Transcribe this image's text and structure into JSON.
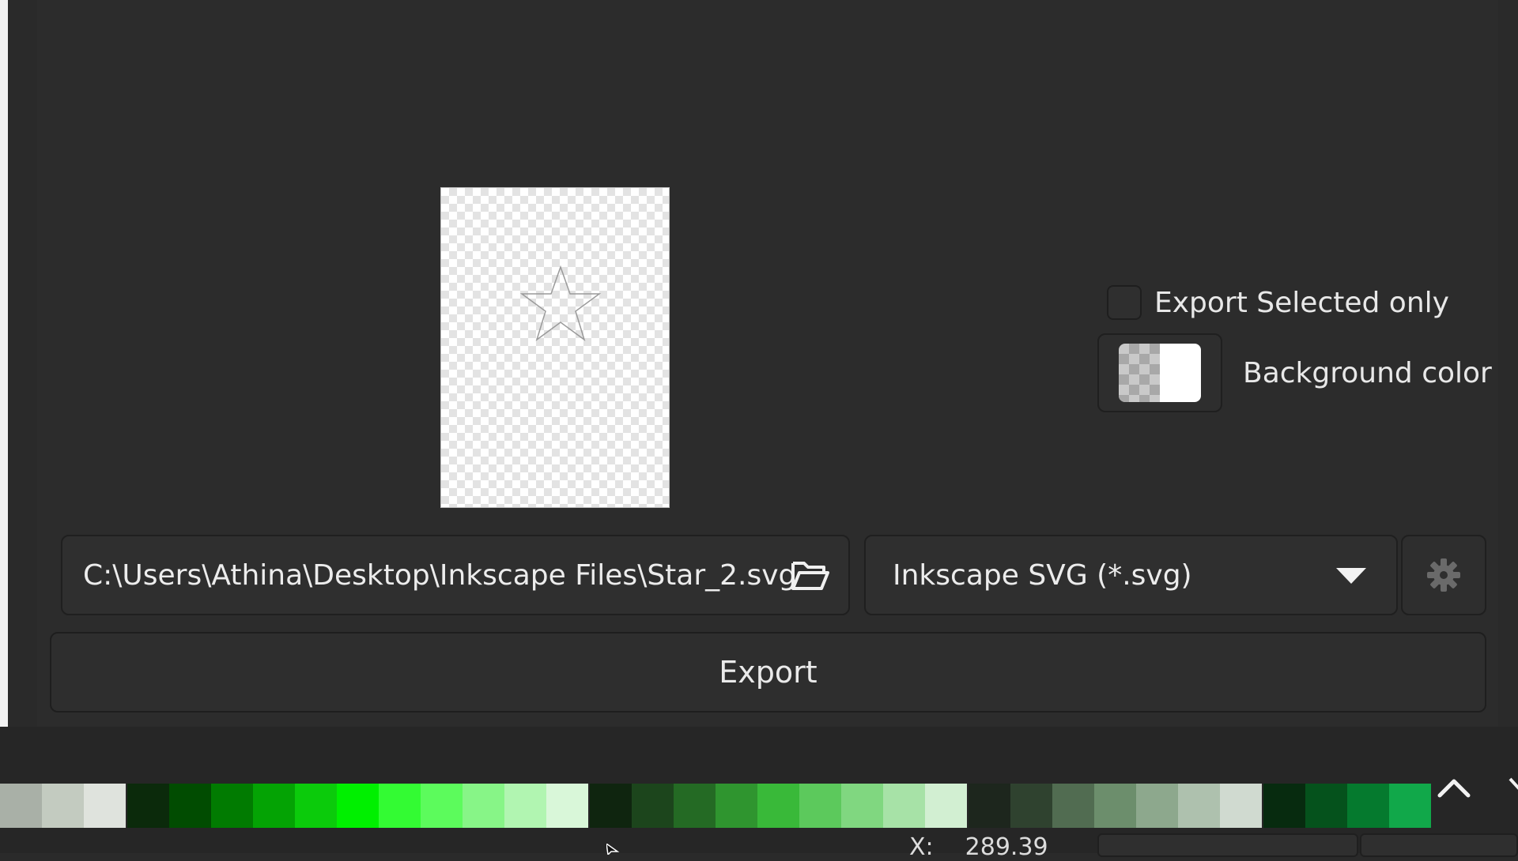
{
  "export_panel": {
    "export_selected_label": "Export Selected only",
    "background_color_label": "Background color",
    "file_path": "C:\\Users\\Athina\\Desktop\\Inkscape Files\\Star_2.svg",
    "file_format": "Inkscape SVG (*.svg)",
    "export_button_label": "Export"
  },
  "icons": {
    "folder": "folder-open-icon",
    "dropdown": "chevron-down-icon",
    "settings": "gear-icon",
    "scroll_up": "chevron-up-icon",
    "preview_star": "star-icon"
  },
  "colors": {
    "panel_bg": "#2c2c2c",
    "palette": [
      "#a9b0a7",
      "#c3cbc0",
      "#dfe3dd",
      "#0b2a0b",
      "#014c01",
      "#017b01",
      "#04a304",
      "#0bcb0b",
      "#00f000",
      "#33fb33",
      "#5cfb5c",
      "#87f587",
      "#b1f5b1",
      "#d9f7d9",
      "#0f250f",
      "#1c451c",
      "#246a24",
      "#2f952f",
      "#39b939",
      "#5cc95c",
      "#80d780",
      "#a7e2a7",
      "#d2efd2",
      "#1d261d",
      "#2f422f",
      "#516c51",
      "#6c8e6c",
      "#8da88d",
      "#aec1ae",
      "#d0dad0",
      "#072b0f",
      "#05521c",
      "#057a2e",
      "#11a84a"
    ]
  },
  "status_bar": {
    "x_label": "X:",
    "x_value": "289.39"
  }
}
